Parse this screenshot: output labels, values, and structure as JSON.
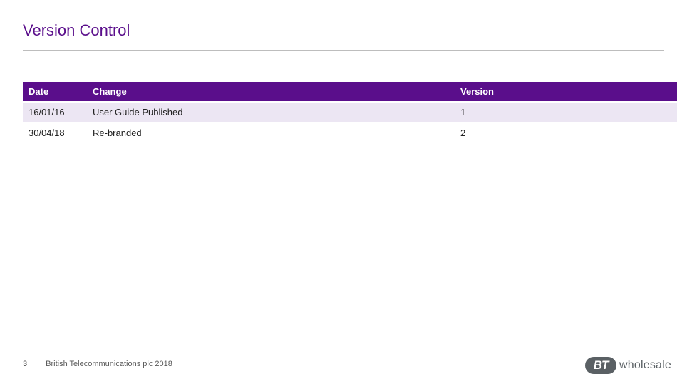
{
  "title": "Version Control",
  "table": {
    "headers": {
      "date": "Date",
      "change": "Change",
      "version": "Version"
    },
    "rows": [
      {
        "date": "16/01/16",
        "change": "User Guide Published",
        "version": "1"
      },
      {
        "date": "30/04/18",
        "change": "Re-branded",
        "version": "2"
      }
    ]
  },
  "footer": {
    "page": "3",
    "copyright": "British Telecommunications plc 2018"
  },
  "logo": {
    "mark": "BT",
    "word": "wholesale"
  }
}
